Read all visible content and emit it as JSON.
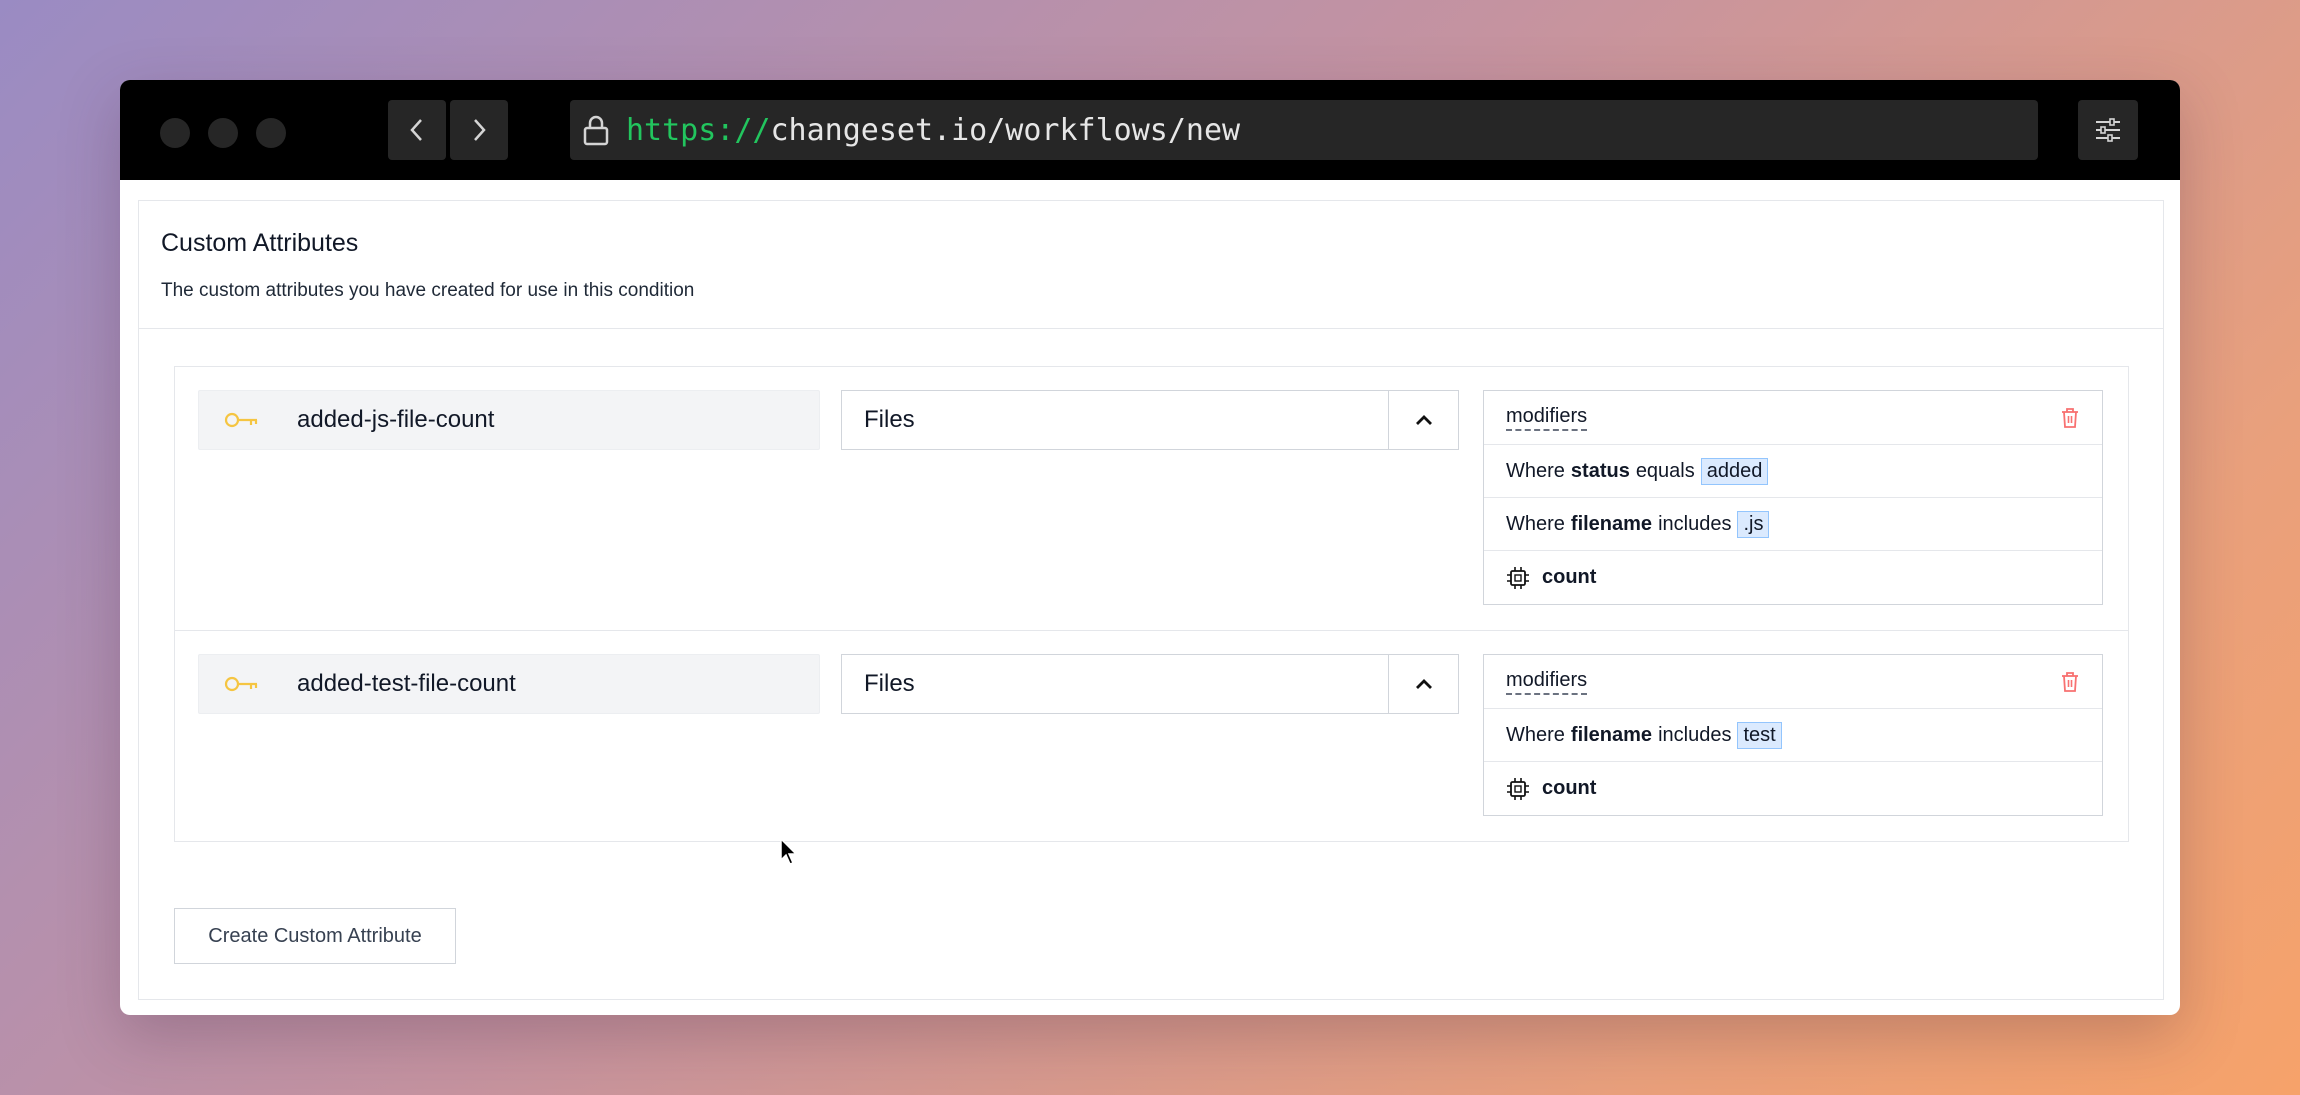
{
  "browser": {
    "url_scheme": "https://",
    "url_rest": "changeset.io/workflows/new"
  },
  "section": {
    "title": "Custom Attributes",
    "subtitle": "The custom attributes you have created for use in this condition"
  },
  "attributes": [
    {
      "name": "added-js-file-count",
      "source": "Files",
      "modifiers_label": "modifiers",
      "conditions": [
        {
          "prefix": "Where",
          "field": "status",
          "op": "equals",
          "value": "added"
        },
        {
          "prefix": "Where",
          "field": "filename",
          "op": "includes",
          "value": ".js"
        }
      ],
      "aggregate": "count"
    },
    {
      "name": "added-test-file-count",
      "source": "Files",
      "modifiers_label": "modifiers",
      "conditions": [
        {
          "prefix": "Where",
          "field": "filename",
          "op": "includes",
          "value": "test"
        }
      ],
      "aggregate": "count"
    }
  ],
  "actions": {
    "create_label": "Create Custom Attribute"
  },
  "colors": {
    "key_icon": "#f5c542",
    "trash_icon": "#f87171",
    "chip_bg": "#dbeafe",
    "url_scheme": "#22c55e"
  }
}
